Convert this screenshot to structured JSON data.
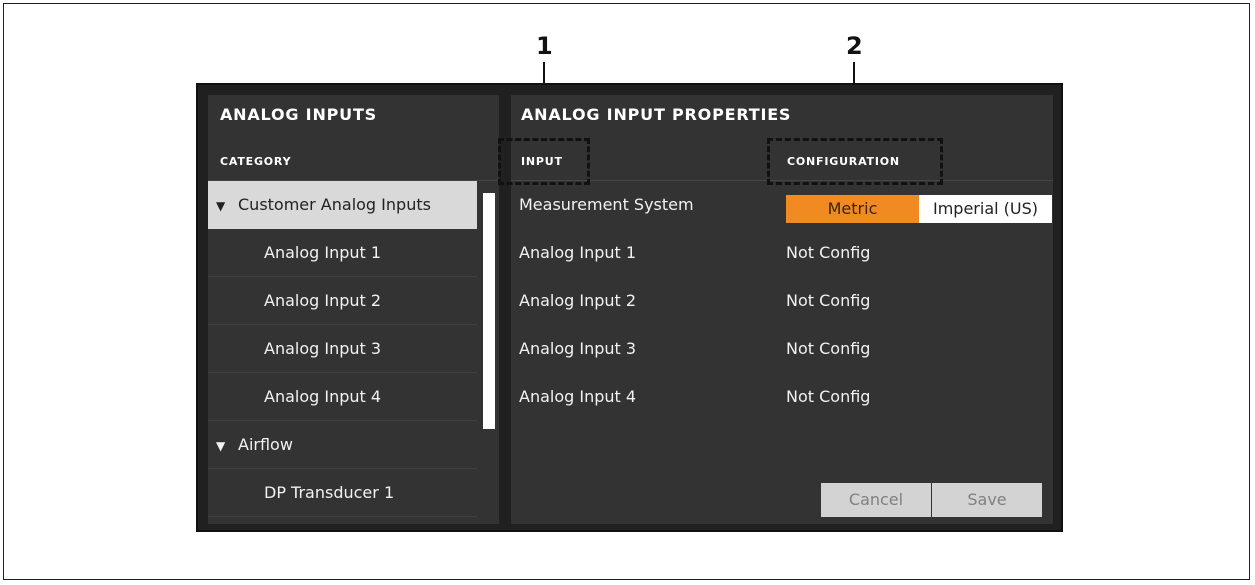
{
  "left_panel": {
    "title": "ANALOG INPUTS",
    "category_header": "CATEGORY",
    "tree": [
      {
        "label": "Customer Analog Inputs",
        "expanded": true,
        "selected": true
      },
      {
        "label": "Analog Input 1"
      },
      {
        "label": "Analog Input 2"
      },
      {
        "label": "Analog Input 3"
      },
      {
        "label": "Analog Input 4"
      },
      {
        "label": "Airflow",
        "expanded": true
      },
      {
        "label": "DP Transducer 1"
      }
    ]
  },
  "right_panel": {
    "title": "ANALOG INPUT PROPERTIES",
    "columns": {
      "input": "INPUT",
      "configuration": "CONFIGURATION"
    },
    "measurement_system": {
      "label": "Measurement System",
      "options": [
        "Metric",
        "Imperial (US)"
      ],
      "selected": "Metric"
    },
    "rows": [
      {
        "input": "Analog Input 1",
        "config": "Not Config"
      },
      {
        "input": "Analog Input 2",
        "config": "Not Config"
      },
      {
        "input": "Analog Input 3",
        "config": "Not Config"
      },
      {
        "input": "Analog Input 4",
        "config": "Not Config"
      }
    ],
    "buttons": {
      "cancel": "Cancel",
      "save": "Save"
    }
  },
  "callouts": [
    "1",
    "2"
  ],
  "colors": {
    "accent": "#f18a21",
    "panel": "#333333",
    "background": "#202020"
  }
}
